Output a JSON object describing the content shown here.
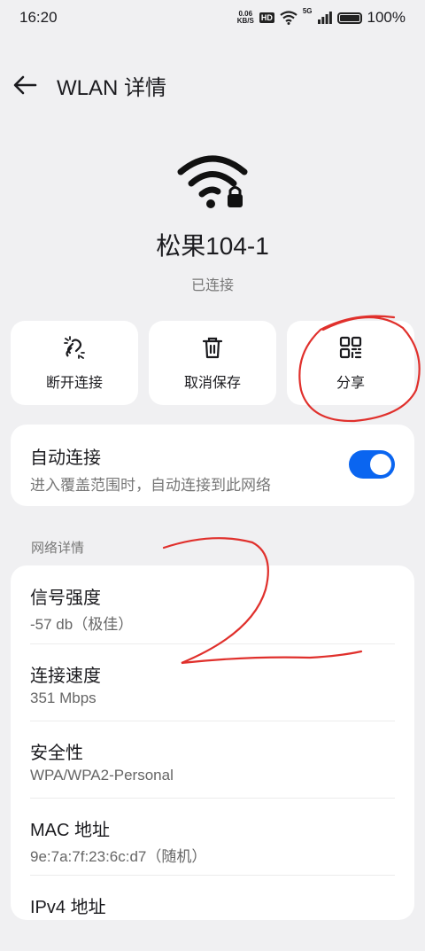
{
  "status": {
    "time": "16:20",
    "net_speed_value": "0.06",
    "net_speed_unit": "KB/S",
    "hd": "HD",
    "network_type": "5G",
    "battery": "100%"
  },
  "appbar": {
    "title": "WLAN 详情"
  },
  "network": {
    "ssid": "松果104-1",
    "status": "已连接"
  },
  "actions": {
    "disconnect": "断开连接",
    "forget": "取消保存",
    "share": "分享"
  },
  "auto_connect": {
    "title": "自动连接",
    "desc": "进入覆盖范围时，自动连接到此网络",
    "enabled": true
  },
  "details": {
    "header": "网络详情",
    "rows": [
      {
        "label": "信号强度",
        "value": "-57 db（极佳）"
      },
      {
        "label": "连接速度",
        "value": "351 Mbps"
      },
      {
        "label": "安全性",
        "value": "WPA/WPA2-Personal"
      },
      {
        "label": "MAC 地址",
        "value": "9e:7a:7f:23:6c:d7（随机）"
      },
      {
        "label": "IPv4 地址",
        "value": ""
      }
    ]
  },
  "colors": {
    "accent": "#0a65f0",
    "annotation": "#e0302c"
  },
  "icons": [
    "back-arrow-icon",
    "wifi-lock-icon",
    "unlink-icon",
    "trash-icon",
    "qr-code-icon",
    "signal-icon",
    "wifi-small-icon",
    "battery-icon"
  ]
}
